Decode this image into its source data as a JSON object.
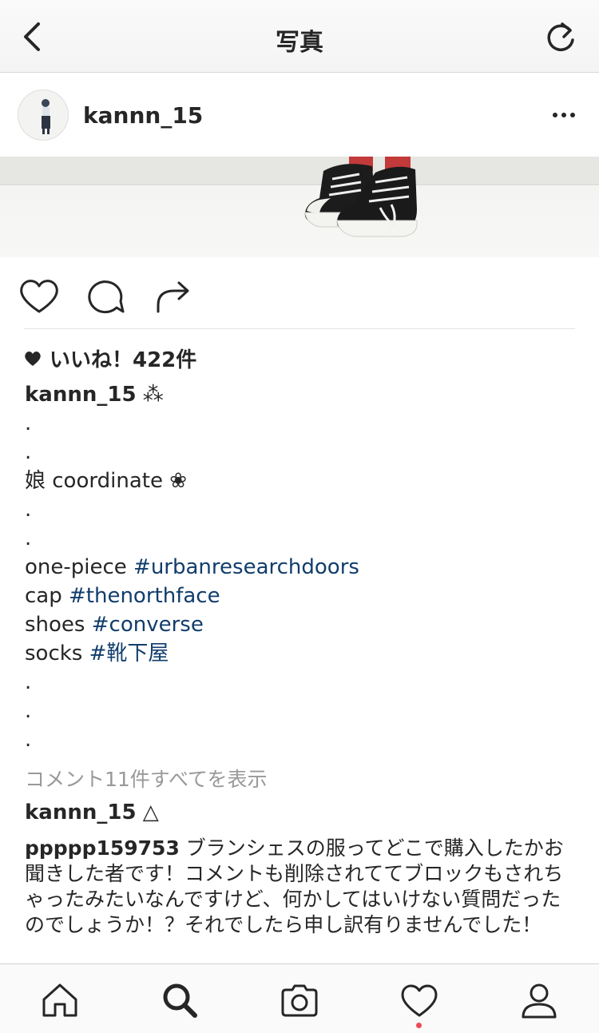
{
  "header": {
    "title": "写真",
    "back_icon": "chevron-left-icon",
    "refresh_icon": "refresh-icon"
  },
  "post": {
    "username": "kannn_15",
    "more_icon": "ellipsis-icon",
    "likes": "いいね！422件",
    "caption": {
      "username": "kannn_15",
      "suffix": " ⁂",
      "lines": [
        {
          "text": ".",
          "tag": ""
        },
        {
          "text": ".",
          "tag": ""
        },
        {
          "text": "娘 coordinate ❀",
          "tag": ""
        },
        {
          "text": ".",
          "tag": ""
        },
        {
          "text": ".",
          "tag": ""
        },
        {
          "text": "one-piece ",
          "tag": "#urbanresearchdoors"
        },
        {
          "text": "cap ",
          "tag": "#thenorthface"
        },
        {
          "text": "shoes ",
          "tag": "#converse"
        },
        {
          "text": "socks ",
          "tag": "#靴下屋"
        },
        {
          "text": ".",
          "tag": ""
        },
        {
          "text": ".",
          "tag": ""
        },
        {
          "text": ".",
          "tag": ""
        }
      ]
    },
    "view_all_comments": "コメント11件すべてを表示",
    "comments": [
      {
        "username": "kannn_15",
        "text": " △"
      },
      {
        "username": "ppppp159753",
        "text": " ブランシェスの服ってどこで購入したかお聞きした者です！コメントも削除されててブロックもされちゃったみたいなんですけど、何かしてはいけない質問だったのでしょうか！？それでしたら申し訳有りませんでした！"
      }
    ]
  },
  "tabbar": {
    "items": [
      "home-icon",
      "search-icon",
      "camera-icon",
      "heart-icon",
      "profile-icon"
    ],
    "active": "search-icon",
    "notification_color": "#ed4956"
  },
  "colors": {
    "hashtag": "#113d6b",
    "muted": "#999999",
    "text": "#262626"
  }
}
